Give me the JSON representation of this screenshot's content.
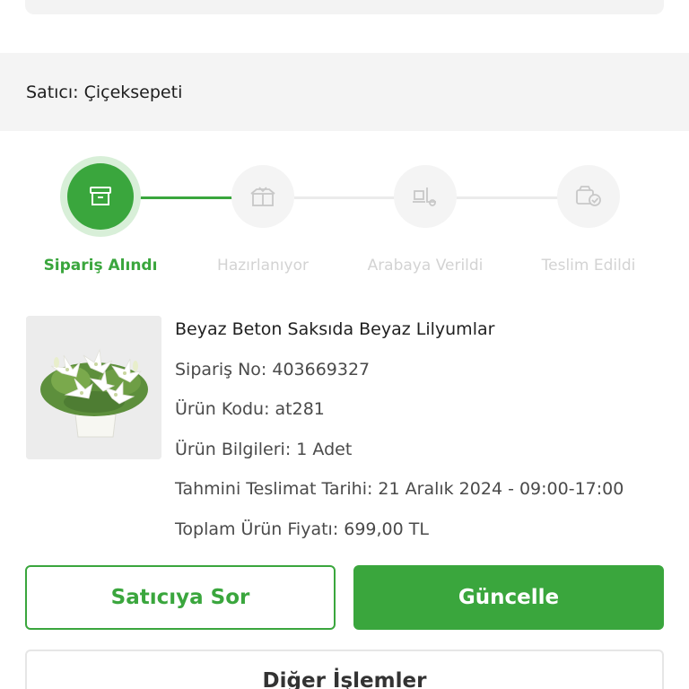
{
  "seller": {
    "label": "Satıcı: Çiçeksepeti"
  },
  "steps": [
    {
      "label": "Sipariş Alındı",
      "icon": "archive-box-icon",
      "active": true
    },
    {
      "label": "Hazırlanıyor",
      "icon": "gift-box-icon",
      "active": false
    },
    {
      "label": "Arabaya Verildi",
      "icon": "delivery-dolly-icon",
      "active": false
    },
    {
      "label": "Teslim Edildi",
      "icon": "box-check-icon",
      "active": false
    }
  ],
  "product": {
    "title": "Beyaz Beton Saksıda Beyaz Lilyumlar",
    "order_no": "Sipariş No: 403669327",
    "product_code": "Ürün Kodu: at281",
    "product_info": "Ürün Bilgileri: 1 Adet",
    "delivery_date": "Tahmini Teslimat Tarihi: 21 Aralık 2024 - 09:00-17:00",
    "total_price": "Toplam Ürün Fiyatı: 699,00 TL"
  },
  "buttons": {
    "ask_seller": "Satıcıya Sor",
    "update": "Güncelle",
    "other_actions": "Diğer İşlemler"
  },
  "colors": {
    "accent": "#3aa63d",
    "accent_light": "#d8efd8",
    "inactive": "#d3d3d3"
  }
}
